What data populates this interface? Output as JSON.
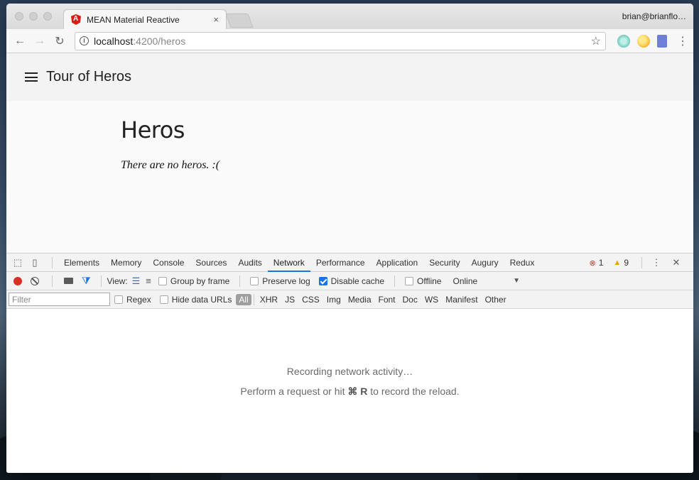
{
  "browser": {
    "tab_title": "MEAN Material Reactive",
    "tab_close": "×",
    "profile": "brian@brianflo…",
    "url_host": "localhost",
    "url_path": ":4200/heros",
    "back": "←",
    "forward": "→",
    "reload": "↻",
    "star": "☆",
    "menu": "⋮"
  },
  "app": {
    "title": "Tour of Heros",
    "heading": "Heros",
    "empty_message": "There are no heros. :("
  },
  "devtools": {
    "tabs": [
      "Elements",
      "Memory",
      "Console",
      "Sources",
      "Audits",
      "Network",
      "Performance",
      "Application",
      "Security",
      "Augury",
      "Redux"
    ],
    "active_tab": "Network",
    "errors": "1",
    "warnings": "9",
    "close": "✕",
    "menu": "⋮",
    "controls": {
      "view_label": "View:",
      "group_by_frame": "Group by frame",
      "preserve_log": "Preserve log",
      "disable_cache": "Disable cache",
      "offline": "Offline",
      "throttle": "Online"
    },
    "filter": {
      "placeholder": "Filter",
      "regex": "Regex",
      "hide_data_urls": "Hide data URLs",
      "types": [
        "All",
        "XHR",
        "JS",
        "CSS",
        "Img",
        "Media",
        "Font",
        "Doc",
        "WS",
        "Manifest",
        "Other"
      ]
    },
    "body": {
      "recording": "Recording network activity…",
      "hint_prefix": "Perform a request or hit",
      "hint_key": "⌘ R",
      "hint_suffix": "to record the reload."
    }
  }
}
